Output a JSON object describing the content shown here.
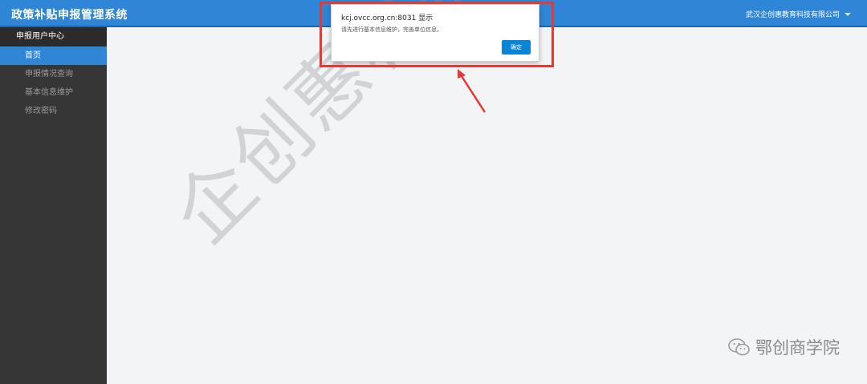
{
  "header": {
    "title": "政策补贴申报管理系统",
    "company": "武汉企创惠教育科技有限公司"
  },
  "sidebar": {
    "section": "申报用户中心",
    "items": [
      {
        "label": "首页",
        "active": true
      },
      {
        "label": "申报情况查询",
        "active": false
      },
      {
        "label": "基本信息维护",
        "active": false
      },
      {
        "label": "修改密码",
        "active": false
      }
    ]
  },
  "dialog": {
    "title": "kcj.ovcc.org.cn:8031 显示",
    "message": "请先进行基本信息维护，完善单位信息。",
    "ok_label": "确定"
  },
  "watermark": "企创惠科技咨询",
  "brand": {
    "name": "鄂创商学院",
    "icon": "wechat-icon"
  },
  "colors": {
    "header": "#2f86d6",
    "sidebar": "#363636",
    "active_item": "#2f86d6",
    "highlight": "#e53935",
    "ok_button": "#0a84d6"
  }
}
